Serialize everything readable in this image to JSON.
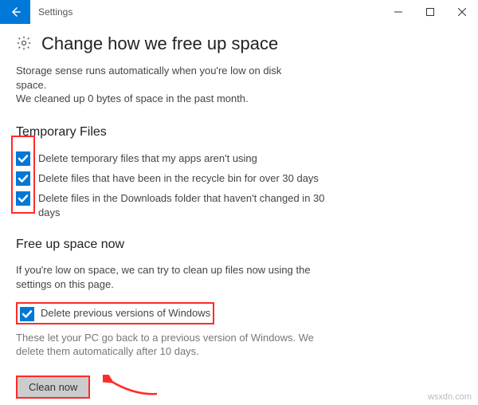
{
  "window": {
    "title": "Settings"
  },
  "page": {
    "heading": "Change how we free up space",
    "summary_line1": "Storage sense runs automatically when you're low on disk space.",
    "summary_line2": "We cleaned up 0 bytes of space in the past month."
  },
  "temp_files": {
    "heading": "Temporary Files",
    "options": [
      "Delete temporary files that my apps aren't using",
      "Delete files that have been in the recycle bin for over 30 days",
      "Delete files in the Downloads folder that haven't changed in 30 days"
    ]
  },
  "free_up": {
    "heading": "Free up space now",
    "description": "If you're low on space, we can try to clean up files now using the settings on this page.",
    "prev_versions_label": "Delete previous versions of Windows",
    "prev_versions_note": "These let your PC go back to a previous version of Windows. We delete them automatically after 10 days.",
    "button_label": "Clean now"
  },
  "watermark": "wsxdn.com"
}
